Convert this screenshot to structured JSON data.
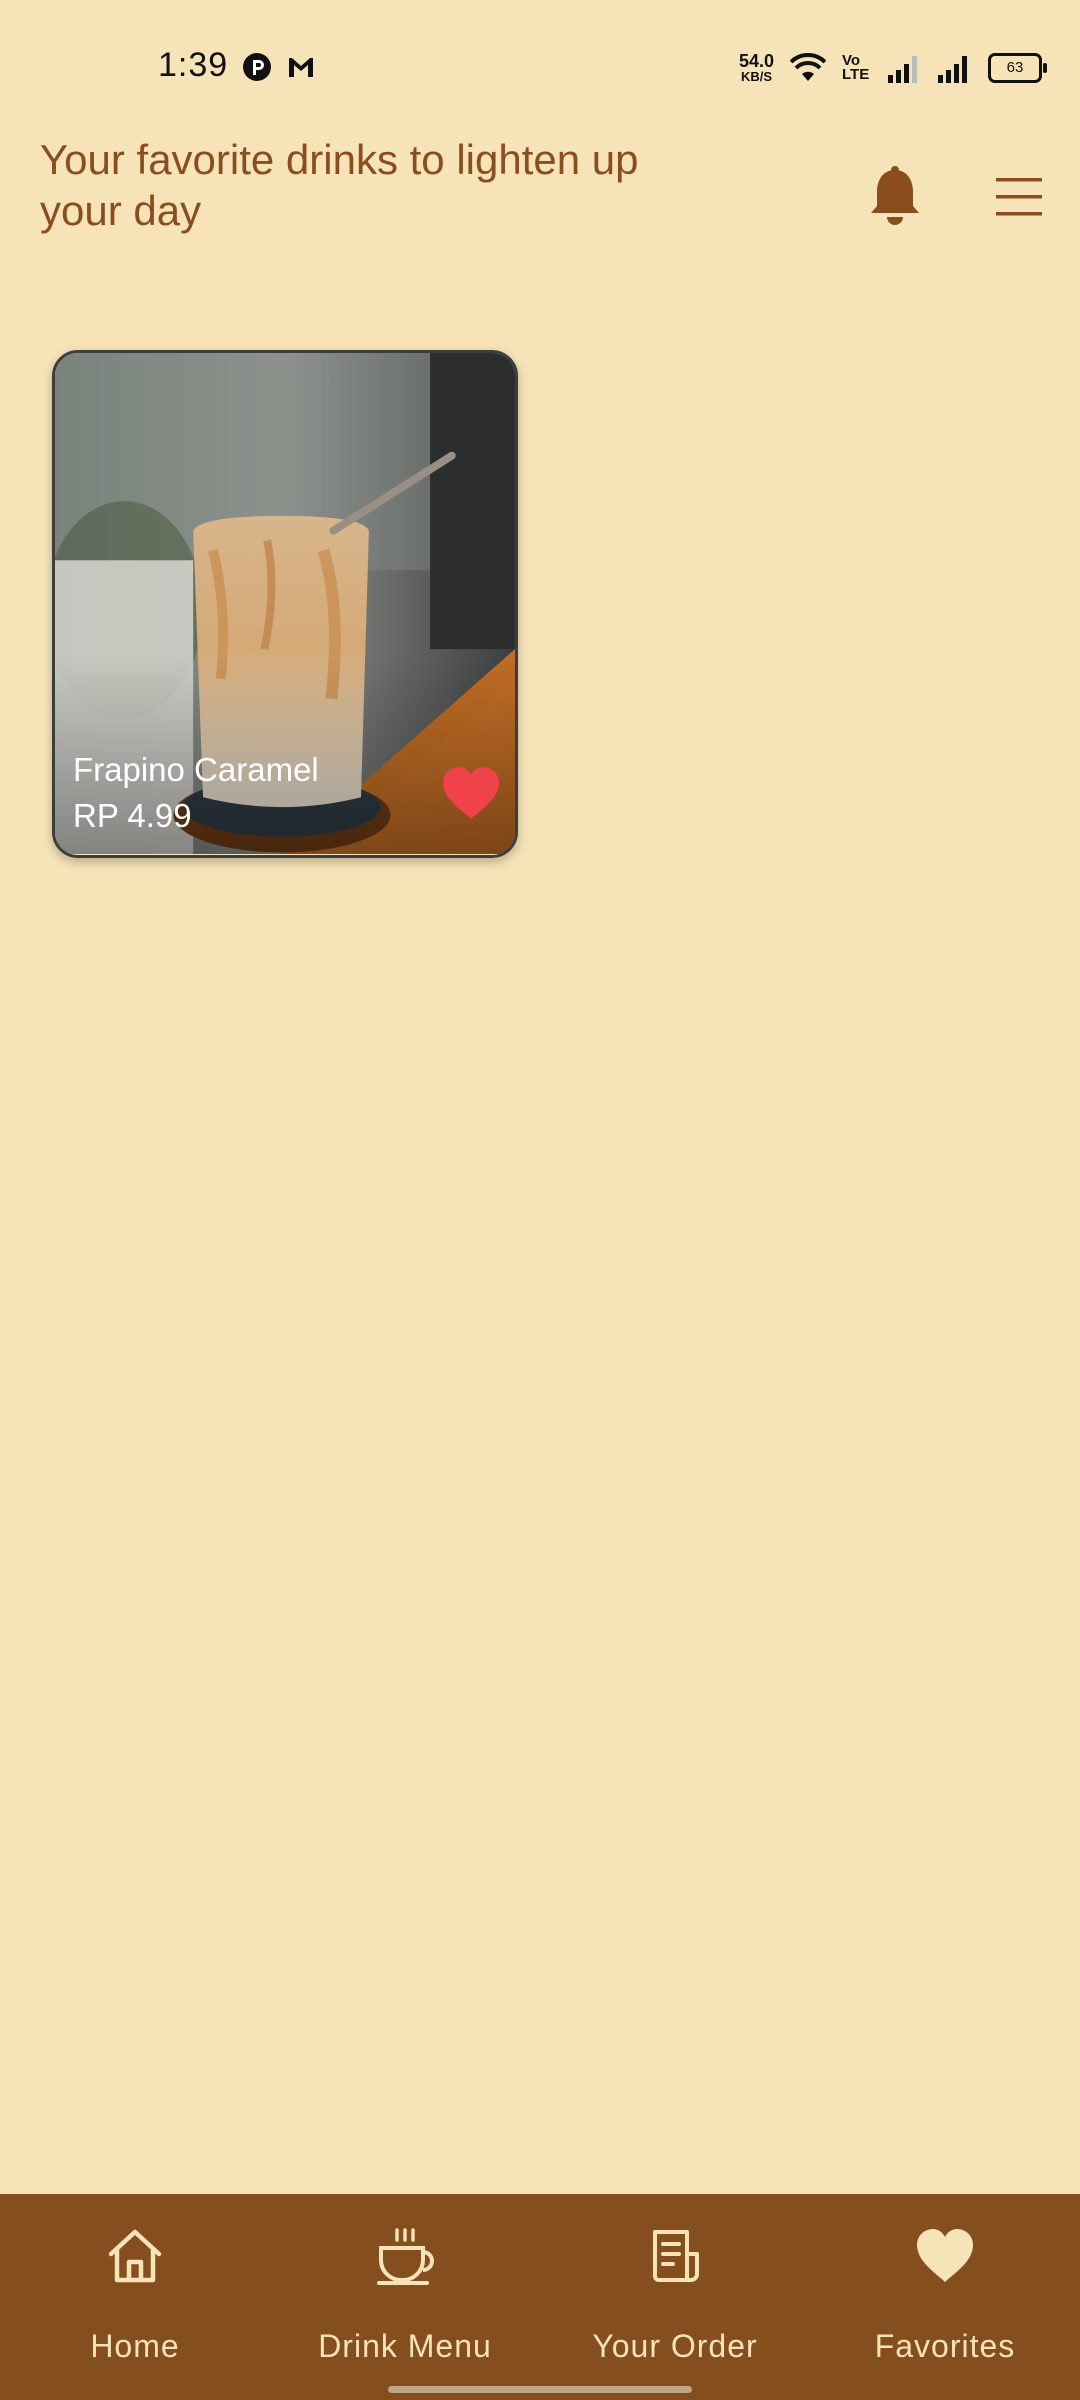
{
  "status_bar": {
    "time": "1:39",
    "speed_value": "54.0",
    "speed_unit": "KB/S",
    "volte": "Vo LTE",
    "battery": "63"
  },
  "header": {
    "title": "Your favorite drinks to lighten up your day",
    "icons": [
      "bell-icon",
      "menu-icon"
    ]
  },
  "favorites": [
    {
      "name": "Frapino Caramel",
      "price": "RP 4.99",
      "favorited": true
    }
  ],
  "bottom_nav": {
    "items": [
      {
        "label": "Home",
        "icon": "home-icon"
      },
      {
        "label": "Drink Menu",
        "icon": "coffee-cup-icon"
      },
      {
        "label": "Your Order",
        "icon": "receipt-icon"
      },
      {
        "label": "Favorites",
        "icon": "heart-icon"
      }
    ],
    "active": "Favorites"
  },
  "colors": {
    "background": "#F6E3B8",
    "accent_brown": "#854E1E",
    "title_brown": "#8A4E1E",
    "heart_red": "#F0424A"
  }
}
